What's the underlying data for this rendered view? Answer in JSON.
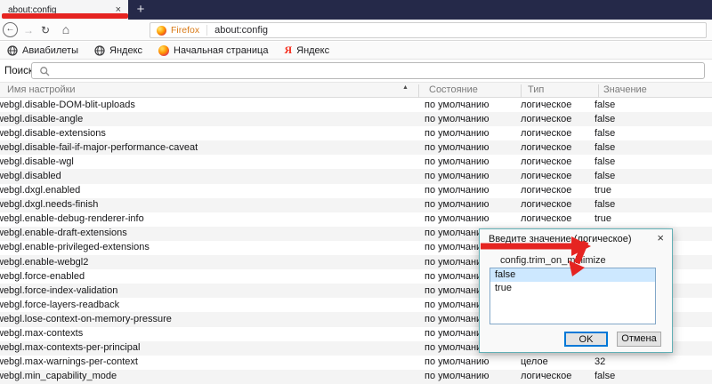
{
  "tabbar": {
    "tab_title": "about:config",
    "close_label": "×",
    "new_tab_label": "+"
  },
  "navbar": {
    "back_glyph": "←",
    "forward_glyph": "→",
    "reload_glyph": "↻",
    "home_glyph": "⌂",
    "identity_badge": "Firefox",
    "url": "about:config"
  },
  "bookmarks": [
    {
      "label": "Авиабилеты",
      "icon": "globe-icon"
    },
    {
      "label": "Яндекс",
      "icon": "globe-icon"
    },
    {
      "label": "Начальная страница",
      "icon": "firefox-ball-icon"
    },
    {
      "label": "Яндекс",
      "icon": "yandex-icon"
    }
  ],
  "search": {
    "label": "Поиск:",
    "value": "",
    "placeholder": ""
  },
  "table": {
    "headers": {
      "name": "Имя настройки",
      "status": "Состояние",
      "type": "Тип",
      "value": "Значение",
      "sort_glyph": "▲"
    },
    "rows": [
      {
        "name": "webgl.disable-DOM-blit-uploads",
        "status": "по умолчанию",
        "type": "логическое",
        "value": "false"
      },
      {
        "name": "webgl.disable-angle",
        "status": "по умолчанию",
        "type": "логическое",
        "value": "false"
      },
      {
        "name": "webgl.disable-extensions",
        "status": "по умолчанию",
        "type": "логическое",
        "value": "false"
      },
      {
        "name": "webgl.disable-fail-if-major-performance-caveat",
        "status": "по умолчанию",
        "type": "логическое",
        "value": "false"
      },
      {
        "name": "webgl.disable-wgl",
        "status": "по умолчанию",
        "type": "логическое",
        "value": "false"
      },
      {
        "name": "webgl.disabled",
        "status": "по умолчанию",
        "type": "логическое",
        "value": "false"
      },
      {
        "name": "webgl.dxgl.enabled",
        "status": "по умолчанию",
        "type": "логическое",
        "value": "true"
      },
      {
        "name": "webgl.dxgl.needs-finish",
        "status": "по умолчанию",
        "type": "логическое",
        "value": "false"
      },
      {
        "name": "webgl.enable-debug-renderer-info",
        "status": "по умолчанию",
        "type": "логическое",
        "value": "true"
      },
      {
        "name": "webgl.enable-draft-extensions",
        "status": "по умолчанию",
        "type": "",
        "value": ""
      },
      {
        "name": "webgl.enable-privileged-extensions",
        "status": "по умолчанию",
        "type": "",
        "value": ""
      },
      {
        "name": "webgl.enable-webgl2",
        "status": "по умолчанию",
        "type": "",
        "value": ""
      },
      {
        "name": "webgl.force-enabled",
        "status": "по умолчанию",
        "type": "",
        "value": ""
      },
      {
        "name": "webgl.force-index-validation",
        "status": "по умолчанию",
        "type": "",
        "value": ""
      },
      {
        "name": "webgl.force-layers-readback",
        "status": "по умолчанию",
        "type": "",
        "value": ""
      },
      {
        "name": "webgl.lose-context-on-memory-pressure",
        "status": "по умолчанию",
        "type": "",
        "value": ""
      },
      {
        "name": "webgl.max-contexts",
        "status": "по умолчанию",
        "type": "",
        "value": ""
      },
      {
        "name": "webgl.max-contexts-per-principal",
        "status": "по умолчанию",
        "type": "",
        "value": ""
      },
      {
        "name": "webgl.max-warnings-per-context",
        "status": "по умолчанию",
        "type": "целое",
        "value": "32"
      },
      {
        "name": "webgl.min_capability_mode",
        "status": "по умолчанию",
        "type": "логическое",
        "value": "false"
      }
    ]
  },
  "dialog": {
    "title": "Введите значение (логическое)",
    "close_label": "×",
    "pref_name": "config.trim_on_minimize",
    "options": [
      "false",
      "true"
    ],
    "selected_option": "false",
    "ok_label": "OK",
    "cancel_label": "Отмена"
  },
  "annotations": {
    "color": "#e52421",
    "tab_underline": true,
    "arrow_target": "dialog-listbox"
  },
  "colors": {
    "tabbar_bg": "#252949",
    "selection_bg": "#cde8ff",
    "dialog_border": "#62b0b6",
    "focus_blue": "#0078d7"
  }
}
